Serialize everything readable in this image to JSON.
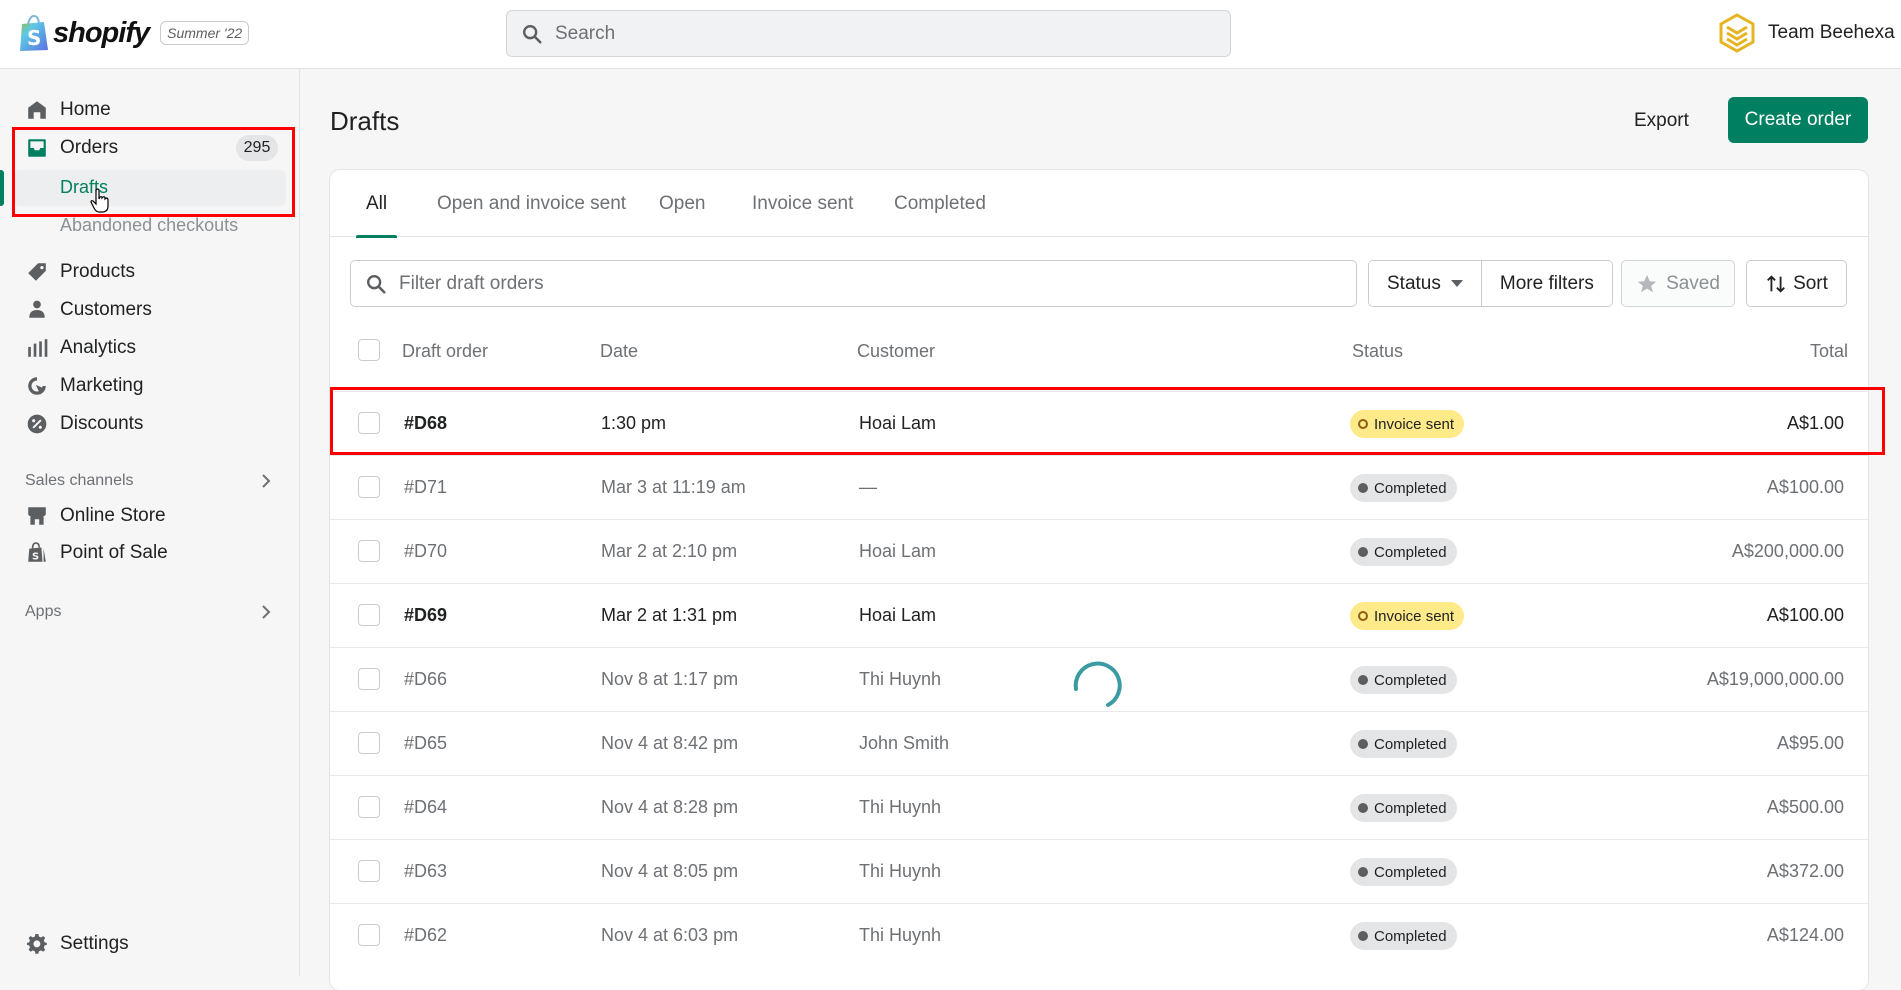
{
  "topbar": {
    "brand": "shopify",
    "season_badge": "Summer '22",
    "search_placeholder": "Search",
    "store_name": "Team Beehexa"
  },
  "sidebar": {
    "items": [
      {
        "label": "Home",
        "icon": "home-icon"
      },
      {
        "label": "Orders",
        "icon": "orders-icon",
        "count": "295"
      },
      {
        "label": "Products",
        "icon": "tag-icon"
      },
      {
        "label": "Customers",
        "icon": "person-icon"
      },
      {
        "label": "Analytics",
        "icon": "bar-chart-icon"
      },
      {
        "label": "Marketing",
        "icon": "target-icon"
      },
      {
        "label": "Discounts",
        "icon": "discount-icon"
      }
    ],
    "orders_sub": [
      {
        "label": "Drafts",
        "active": true
      },
      {
        "label": "Abandoned checkouts"
      }
    ],
    "sales_channels_label": "Sales channels",
    "channels": [
      {
        "label": "Online Store",
        "icon": "store-icon"
      },
      {
        "label": "Point of Sale",
        "icon": "pos-bag-icon"
      }
    ],
    "apps_label": "Apps",
    "settings_label": "Settings"
  },
  "page": {
    "title": "Drafts",
    "export_label": "Export",
    "create_label": "Create order"
  },
  "tabs": [
    "All",
    "Open and invoice sent",
    "Open",
    "Invoice sent",
    "Completed"
  ],
  "active_tab": "All",
  "filters": {
    "placeholder": "Filter draft orders",
    "status_label": "Status",
    "more_filters_label": "More filters",
    "saved_label": "Saved",
    "sort_label": "Sort"
  },
  "table": {
    "headers": {
      "order": "Draft order",
      "date": "Date",
      "customer": "Customer",
      "status": "Status",
      "total": "Total"
    },
    "rows": [
      {
        "order": "#D68",
        "date": "1:30 pm",
        "customer": "Hoai Lam",
        "status": "Invoice sent",
        "total": "A$1.00",
        "bold": true
      },
      {
        "order": "#D71",
        "date": "Mar 3 at 11:19 am",
        "customer": "—",
        "status": "Completed",
        "total": "A$100.00",
        "bold": false
      },
      {
        "order": "#D70",
        "date": "Mar 2 at 2:10 pm",
        "customer": "Hoai Lam",
        "status": "Completed",
        "total": "A$200,000.00",
        "bold": false
      },
      {
        "order": "#D69",
        "date": "Mar 2 at 1:31 pm",
        "customer": "Hoai Lam",
        "status": "Invoice sent",
        "total": "A$100.00",
        "bold": true
      },
      {
        "order": "#D66",
        "date": "Nov 8 at 1:17 pm",
        "customer": "Thi Huynh",
        "status": "Completed",
        "total": "A$19,000,000.00",
        "bold": false
      },
      {
        "order": "#D65",
        "date": "Nov 4 at 8:42 pm",
        "customer": "John Smith",
        "status": "Completed",
        "total": "A$95.00",
        "bold": false
      },
      {
        "order": "#D64",
        "date": "Nov 4 at 8:28 pm",
        "customer": "Thi Huynh",
        "status": "Completed",
        "total": "A$500.00",
        "bold": false
      },
      {
        "order": "#D63",
        "date": "Nov 4 at 8:05 pm",
        "customer": "Thi Huynh",
        "status": "Completed",
        "total": "A$372.00",
        "bold": false
      },
      {
        "order": "#D62",
        "date": "Nov 4 at 6:03 pm",
        "customer": "Thi Huynh",
        "status": "Completed",
        "total": "A$124.00",
        "bold": false
      }
    ]
  },
  "colors": {
    "primary": "#008060",
    "invoice_badge": "#ffea8a",
    "completed_badge": "#e4e5e7",
    "highlight": "#ff0000",
    "spinner": "#3b9ba3"
  }
}
